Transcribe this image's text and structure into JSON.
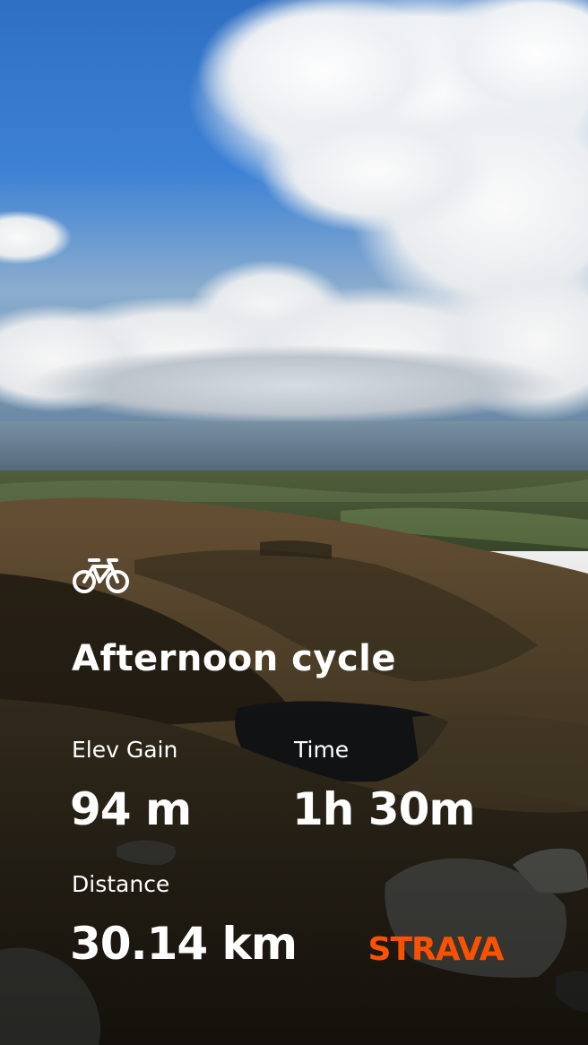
{
  "activity": {
    "type_icon": "bicycle-icon",
    "title": "Afternoon cycle"
  },
  "stats": {
    "elev_gain": {
      "label": "Elev Gain",
      "value": "94 m"
    },
    "time": {
      "label": "Time",
      "value": "1h 30m"
    },
    "distance": {
      "label": "Distance",
      "value": "30.14 km"
    }
  },
  "brand": {
    "name": "STRAVA",
    "color": "#FC5200"
  },
  "colors": {
    "text": "#FFFFFF"
  }
}
